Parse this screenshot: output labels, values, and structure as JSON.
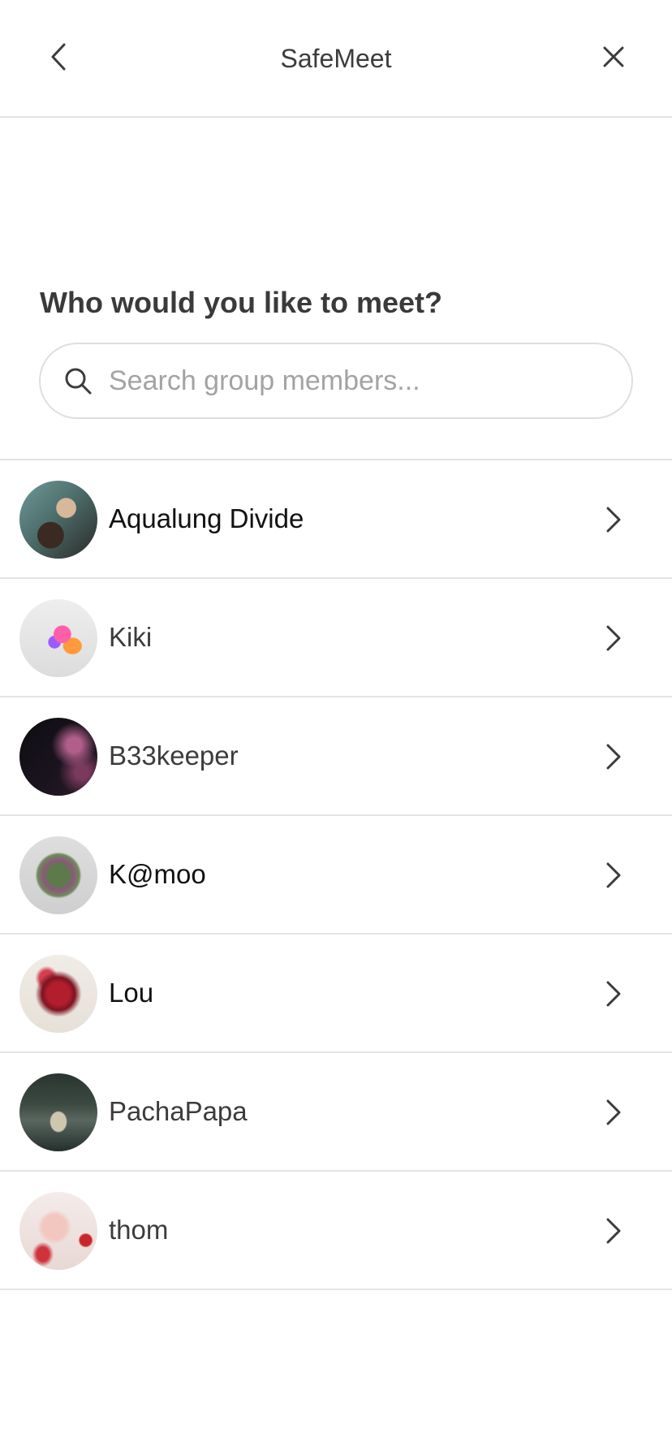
{
  "header": {
    "title": "SafeMeet",
    "back_icon": "chevron-left-icon",
    "close_icon": "close-icon"
  },
  "prompt": {
    "heading": "Who would you like to meet?"
  },
  "search": {
    "placeholder": "Search group members...",
    "value": "",
    "icon": "search-icon"
  },
  "members": [
    {
      "name": "Aqualung Divide"
    },
    {
      "name": "Kiki"
    },
    {
      "name": "B33keeper"
    },
    {
      "name": "K@moo"
    },
    {
      "name": "Lou"
    },
    {
      "name": "PachaPapa"
    },
    {
      "name": "thom"
    }
  ],
  "colors": {
    "text": "#3c3c3c",
    "divider": "#e3e3e3",
    "placeholder": "#a3a3a3",
    "background": "#ffffff"
  }
}
